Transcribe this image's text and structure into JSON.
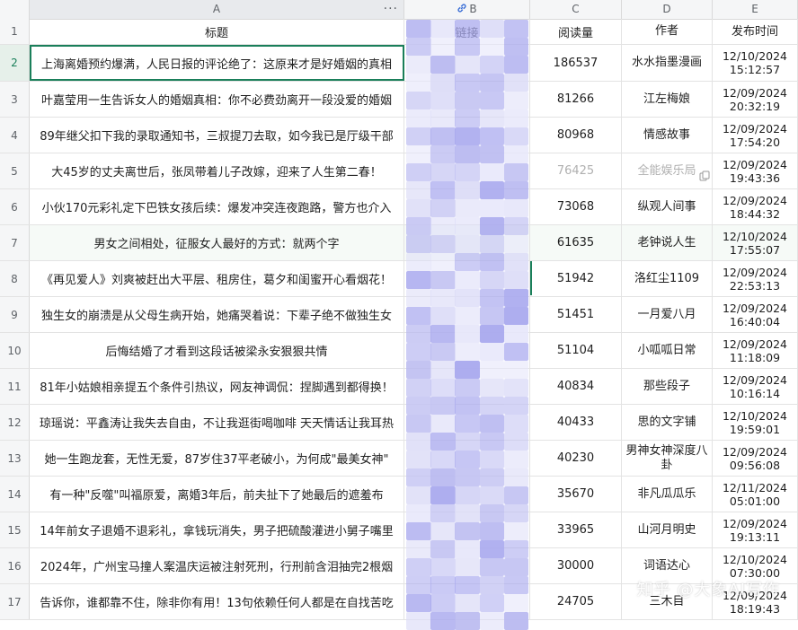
{
  "columns": {
    "a": "A",
    "b": "B",
    "c": "C",
    "d": "D",
    "e": "E",
    "a_menu": "···"
  },
  "header": {
    "row_number": "1",
    "title": "标题",
    "link": "链接",
    "reads": "阅读量",
    "author": "作者",
    "published": "发布时间"
  },
  "rows": [
    {
      "n": "2",
      "title": "上海离婚预约爆满，人民日报的评论绝了：这原来才是好婚姻的真相",
      "reads": "186537",
      "author": "水水指墨漫画",
      "time": "12/10/2024\n15:12:57"
    },
    {
      "n": "3",
      "title": "叶嘉莹用一生告诉女人的婚姻真相：你不必费劲离开一段没爱的婚姻",
      "reads": "81266",
      "author": "江左梅娘",
      "time": "12/09/2024\n20:32:19"
    },
    {
      "n": "4",
      "title": "89年继父扣下我的录取通知书，三叔提刀去取，如今我已是厅级干部",
      "reads": "80968",
      "author": "情感故事",
      "time": "12/09/2024\n17:54:20"
    },
    {
      "n": "5",
      "title": "大45岁的丈夫离世后，张凤带着儿子改嫁，迎来了人生第二春！",
      "reads": "76425",
      "author": "全能娱乐局",
      "time": "12/09/2024\n19:43:36"
    },
    {
      "n": "6",
      "title": "小伙170元彩礼定下巴铁女孩后续：爆发冲突连夜跑路，警方也介入",
      "reads": "73068",
      "author": "纵观人间事",
      "time": "12/09/2024\n18:44:32"
    },
    {
      "n": "7",
      "title": "男女之间相处，征服女人最好的方式：就两个字",
      "reads": "61635",
      "author": "老钟说人生",
      "time": "12/10/2024\n17:55:07"
    },
    {
      "n": "8",
      "title": "《再见爱人》刘爽被赶出大平层、租房住，葛夕和闺蜜开心看烟花！",
      "reads": "51942",
      "author": "洛红尘1109",
      "time": "12/09/2024\n22:53:13"
    },
    {
      "n": "9",
      "title": "独生女的崩溃是从父母生病开始，她痛哭着说：下辈子绝不做独生女",
      "reads": "51451",
      "author": "一月爱八月",
      "time": "12/09/2024\n16:40:04"
    },
    {
      "n": "10",
      "title": "后悔结婚了才看到这段话被梁永安狠狠共情",
      "reads": "51104",
      "author": "小呱呱日常",
      "time": "12/09/2024\n11:18:09"
    },
    {
      "n": "11",
      "title": "81年小姑娘相亲提五个条件引热议，网友神调侃：捏脚遇到都得换！",
      "reads": "40834",
      "author": "那些段子",
      "time": "12/09/2024\n10:16:14"
    },
    {
      "n": "12",
      "title": "琼瑶说：平鑫涛让我失去自由，不让我逛街喝咖啡 天天情话让我耳热",
      "reads": "40433",
      "author": "思的文字铺",
      "time": "12/10/2024\n19:59:01"
    },
    {
      "n": "13",
      "title": "她一生跑龙套，无性无爱，87岁住37平老破小，为何成\"最美女神\"",
      "reads": "40230",
      "author": "男神女神深度八卦",
      "time": "12/09/2024\n09:56:08"
    },
    {
      "n": "14",
      "title": "有一种\"反噬\"叫福原爱，离婚3年后，前夫扯下了她最后的遮羞布",
      "reads": "35670",
      "author": "非凡瓜瓜乐",
      "time": "12/11/2024\n05:01:00"
    },
    {
      "n": "15",
      "title": "14年前女子退婚不退彩礼，拿钱玩消失，男子把硫酸灌进小舅子嘴里",
      "reads": "33965",
      "author": "山河月明史",
      "time": "12/09/2024\n19:13:11"
    },
    {
      "n": "16",
      "title": "2024年，广州宝马撞人案温庆运被注射死刑，行刑前含泪抽完2根烟",
      "reads": "30000",
      "author": "词语达心",
      "time": "12/10/2024\n07:30:00"
    },
    {
      "n": "17",
      "title": "告诉你，谁都靠不住，除非你有用！13句依赖任何人都是在自找苦吃",
      "reads": "24705",
      "author": "三木目",
      "time": "12/09/2024\n18:19:43"
    }
  ],
  "watermark": "知乎 @大象AI写作",
  "colors": {
    "selection": "#1a7f5a",
    "mask_light": "#dcdcf7",
    "mask_mid": "#c3c3f2",
    "mask_dark": "#a9a9ee"
  },
  "icons": {
    "link": "link-icon",
    "menu": "more-dots-icon",
    "copy": "copy-icon"
  }
}
